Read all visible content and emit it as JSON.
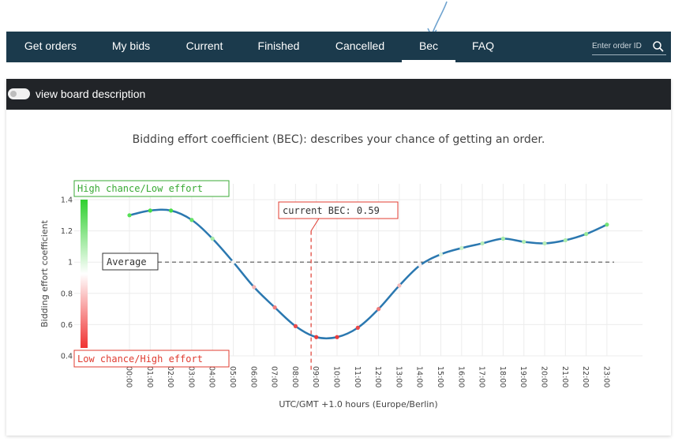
{
  "nav": {
    "items": [
      "Get orders",
      "My bids",
      "Current",
      "Finished",
      "Cancelled",
      "Bec",
      "FAQ"
    ],
    "active": "Bec",
    "search_placeholder": "Enter order ID"
  },
  "board": {
    "toggle_label": "view board description"
  },
  "colors": {
    "navbar": "#1b3a4c",
    "desc_bar": "#212428",
    "line": "#2b78b0",
    "high": "#3aaa35",
    "low": "#e03c31"
  },
  "chart_data": {
    "type": "line",
    "title": "Bidding effort coefficient (BEC): describes your chance of getting an order.",
    "xlabel": "UTC/GMT +1.0 hours (Europe/Berlin)",
    "ylabel": "Bidding effort coefficient",
    "ylim": [
      0.4,
      1.4
    ],
    "yticks": [
      "0.4",
      "0.6",
      "0.8",
      "1",
      "1.2",
      "1.4"
    ],
    "categories": [
      "00:00",
      "01:00",
      "02:00",
      "03:00",
      "04:00",
      "05:00",
      "06:00",
      "07:00",
      "08:00",
      "09:00",
      "10:00",
      "11:00",
      "12:00",
      "13:00",
      "14:00",
      "15:00",
      "16:00",
      "17:00",
      "18:00",
      "19:00",
      "20:00",
      "21:00",
      "22:00",
      "23:00"
    ],
    "series": [
      {
        "values": [
          1.3,
          1.33,
          1.33,
          1.27,
          1.15,
          1.0,
          0.84,
          0.71,
          0.59,
          0.52,
          0.52,
          0.58,
          0.7,
          0.85,
          0.98,
          1.05,
          1.09,
          1.12,
          1.15,
          1.13,
          1.12,
          1.14,
          1.18,
          1.24
        ]
      }
    ],
    "average": {
      "label": "Average",
      "value": 1.0
    },
    "current": {
      "label": "current BEC: 0.59",
      "value": 0.59,
      "x_position": 8.75
    },
    "scale_labels": {
      "high": "High chance/Low effort",
      "low": "Low chance/High effort"
    },
    "grid": true
  }
}
